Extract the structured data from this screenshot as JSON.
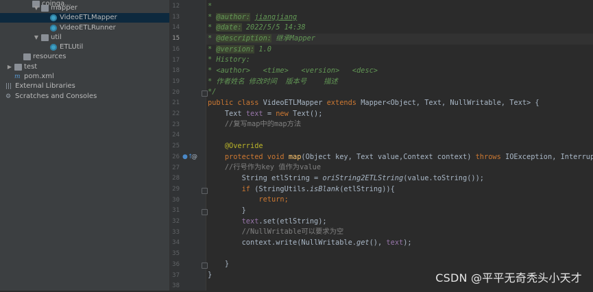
{
  "project_tree": {
    "items": [
      {
        "label": "coinga...",
        "kind": "folder",
        "depth": 4
      },
      {
        "label": "mapper",
        "kind": "folder",
        "depth": 5,
        "expanded": true
      },
      {
        "label": "VideoETLMapper",
        "kind": "java",
        "depth": 6,
        "selected": true
      },
      {
        "label": "VideoETLRunner",
        "kind": "java",
        "depth": 6
      },
      {
        "label": "util",
        "kind": "folder",
        "depth": 5,
        "expanded": true
      },
      {
        "label": "ETLUtil",
        "kind": "java",
        "depth": 6
      },
      {
        "label": "resources",
        "kind": "folder",
        "depth": 3
      },
      {
        "label": "test",
        "kind": "folder",
        "depth": 2,
        "collapsed": true
      },
      {
        "label": "pom.xml",
        "kind": "xml",
        "depth": 2
      },
      {
        "label": "External Libraries",
        "kind": "lib",
        "depth": 1
      },
      {
        "label": "Scratches and Consoles",
        "kind": "scratch",
        "depth": 1
      }
    ]
  },
  "editor": {
    "line_numbers": [
      "12",
      "13",
      "14",
      "15",
      "16",
      "17",
      "18",
      "19",
      "20",
      "21",
      "22",
      "23",
      "24",
      "25",
      "26",
      "27",
      "28",
      "29",
      "30",
      "31",
      "32",
      "33",
      "34",
      "35",
      "36",
      "37",
      "38"
    ],
    "current_line": "15",
    "doc": {
      "star": "*",
      "author_tag": "@author:",
      "author_val": "jiangjiang",
      "date_tag": "@date:",
      "date_val": "2022/5/5 14:38",
      "desc_tag": "@description:",
      "desc_val": "继承Mapper",
      "version_tag": "@version:",
      "version_val": "1.0",
      "history": "History:",
      "tags_line": "<author>   <time>   <version>   <desc>",
      "cn_line": "作者姓名 修改时间  版本号    描述",
      "close": "*/"
    },
    "code": {
      "l21_kw": "public class",
      "l21_cls": " VideoETLMapper ",
      "l21_ext": "extends",
      "l21_rest": " Mapper<Object, Text, NullWritable, Text> {",
      "l22_a": "Text ",
      "l22_fld": "text",
      "l22_b": " = ",
      "l22_new": "new",
      "l22_c": " Text();",
      "l23_cm": "//复写map中的map方法",
      "l25_ann": "@Override",
      "l26_kw": "protected void",
      "l26_sp": " ",
      "l26_fn": "map",
      "l26_params": "(Object key, Text value,Context context) ",
      "l26_throws": "throws",
      "l26_exc": " IOException, InterruptedExcep",
      "l27_cm": "//行号作为key 值作为value",
      "l28_a": "String etlString = ",
      "l28_st": "oriString2ETLString",
      "l28_b": "(value.toString());",
      "l29_if": "if",
      "l29_a": " (StringUtils.",
      "l29_st": "isBlank",
      "l29_b": "(etlString)){",
      "l30_ret": "return",
      "l30_semi": ";",
      "l31": "}",
      "l32_fld": "text",
      "l32_b": ".set(etlString);",
      "l33_cm": "//NullWritable可以要求为空",
      "l34_a": "context.write(NullWritable.",
      "l34_st": "get",
      "l34_b": "(), ",
      "l34_fld": "text",
      "l34_c": ");",
      "l36": "}",
      "l37": "}"
    },
    "gutter_icons": {
      "override": "●↑",
      "at": "@"
    }
  },
  "watermark": "CSDN @平平无奇秃头小天才",
  "colors": {
    "tree_bg": "#3c3f41",
    "editor_bg": "#2b2b2b",
    "selection": "#0d293e",
    "keyword": "#cc7832",
    "doc_green": "#629755",
    "annotation": "#bbb529",
    "field": "#9876aa",
    "function": "#ffc66d"
  }
}
